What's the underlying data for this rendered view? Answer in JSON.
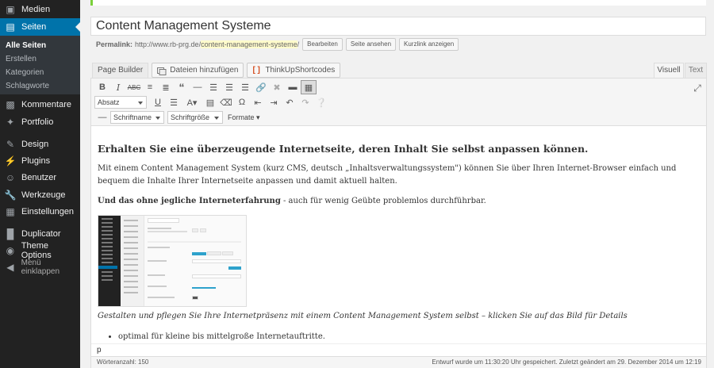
{
  "sidebar": {
    "items": [
      {
        "label": "Medien",
        "icon": "media-icon"
      },
      {
        "label": "Seiten",
        "icon": "pages-icon",
        "active": true
      },
      {
        "label": "Kommentare",
        "icon": "comments-icon"
      },
      {
        "label": "Portfolio",
        "icon": "portfolio-icon"
      },
      {
        "label": "Design",
        "icon": "appearance-icon"
      },
      {
        "label": "Plugins",
        "icon": "plugins-icon"
      },
      {
        "label": "Benutzer",
        "icon": "users-icon"
      },
      {
        "label": "Werkzeuge",
        "icon": "tools-icon"
      },
      {
        "label": "Einstellungen",
        "icon": "settings-icon"
      },
      {
        "label": "Duplicator",
        "icon": "duplicator-icon"
      },
      {
        "label": "Theme Options",
        "icon": "theme-options-icon"
      },
      {
        "label": "Menü einklappen",
        "icon": "collapse-icon"
      }
    ],
    "submenu": [
      "Alle Seiten",
      "Erstellen",
      "Kategorien",
      "Schlagworte"
    ]
  },
  "editor": {
    "title": "Content Management Systeme",
    "permalink_label": "Permalink:",
    "permalink_base": "http://www.rb-prg.de/",
    "permalink_slug": "content-management-systeme",
    "permalink_end": "/",
    "buttons": {
      "edit": "Bearbeiten",
      "view": "Seite ansehen",
      "shortlink": "Kurzlink anzeigen"
    },
    "tab_pagebuilder": "Page Builder",
    "add_media": "Dateien hinzufügen",
    "shortcodes": "ThinkUpShortcodes",
    "tab_visual": "Visuell",
    "tab_text": "Text",
    "toolbar": {
      "format_select": "Absatz",
      "font_family": "Schriftname",
      "font_size": "Schriftgröße",
      "formats": "Formate"
    },
    "content": {
      "heading": "Erhalten Sie eine überzeugende Internetseite, deren Inhalt Sie selbst anpassen können.",
      "paragraph1": "Mit einem Content Management System (kurz CMS, deutsch „Inhaltsverwaltungssystem\") können Sie über Ihren Internet-Browser einfach und bequem die Inhalte Ihrer Internetseite anpassen und damit aktuell halten.",
      "lead_bold": "Und das ohne jegliche Interneterfahrung",
      "lead_rest": " - auch für wenig Geübte problemlos durchführbar.",
      "caption": "Gestalten und pflegen Sie Ihre Internetpräsenz mit einem Content Management System selbst – klicken Sie auf das Bild für Details",
      "list": [
        "optimal für kleine bis mittelgroße Internetauftritte."
      ]
    },
    "path": "p",
    "word_count": "Wörteranzahl: 150",
    "saved_status": "Entwurf wurde um 11:30:20 Uhr gespeichert. Zuletzt geändert am 29. Dezember 2014 um 12:19"
  },
  "colors": {
    "sidebar_bg": "#222222",
    "active_blue": "#0073aa",
    "notice_green": "#7ad03a",
    "slug_highlight": "#fffbcc"
  }
}
